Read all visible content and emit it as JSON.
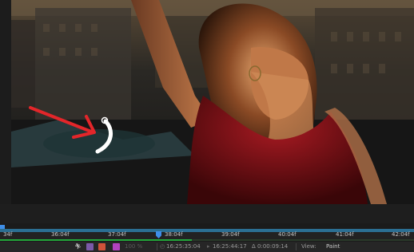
{
  "timeline": {
    "ticks": [
      "34f",
      "36:04f",
      "37:04f",
      "38:04f",
      "39:04f",
      "40:04f",
      "41:04f",
      "42:04f"
    ]
  },
  "statusbar": {
    "zoom": "100 %",
    "current_time": "16:25:35:04",
    "end_time": "16:25:44:17",
    "duration": "Δ 0:00:09:14",
    "view_label": "View:",
    "view_mode": "Paint"
  },
  "colors": {
    "accent": "#3f8ee8",
    "cache": "#22a83a",
    "work_area": "#2b6f93",
    "annotation_arrow": "#e3262a",
    "stroke": "#ffffff"
  },
  "icons": {
    "roto": "roto-brush-icon",
    "solo": "solo-icon",
    "color_swatch": "color-swatch-icon"
  }
}
